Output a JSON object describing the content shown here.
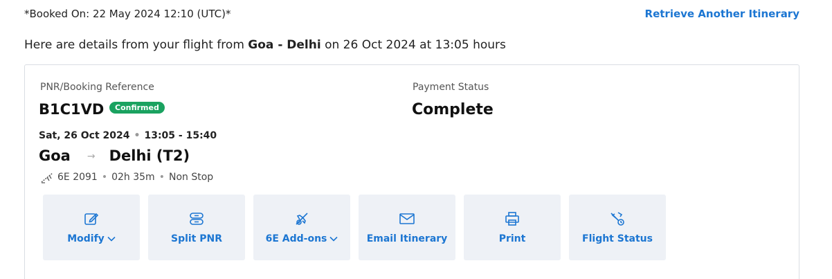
{
  "header": {
    "booked_on": "*Booked On: 22 May 2024 12:10 (UTC)*",
    "retrieve_link": "Retrieve Another Itinerary",
    "details_prefix": "Here are details from your flight from ",
    "details_route": "Goa - Delhi",
    "details_suffix": " on 26 Oct 2024 at 13:05 hours"
  },
  "booking": {
    "pnr_label": "PNR/Booking Reference",
    "pnr": "B1C1VD",
    "status_badge": "Confirmed",
    "payment_label": "Payment Status",
    "payment_value": "Complete"
  },
  "flight": {
    "date": "Sat, 26 Oct 2024",
    "time": "13:05 - 15:40",
    "origin": "Goa",
    "destination": "Delhi (T2)",
    "flight_no": "6E 2091",
    "duration": "02h 35m",
    "stops": "Non Stop"
  },
  "actions": [
    {
      "label": "Modify",
      "icon": "edit-icon",
      "dropdown": true
    },
    {
      "label": "Split PNR",
      "icon": "split-icon",
      "dropdown": false
    },
    {
      "label": "6E Add-ons",
      "icon": "addons-icon",
      "dropdown": true
    },
    {
      "label": "Email Itinerary",
      "icon": "mail-icon",
      "dropdown": false
    },
    {
      "label": "Print",
      "icon": "printer-icon",
      "dropdown": false
    },
    {
      "label": "Flight Status",
      "icon": "flight-status-icon",
      "dropdown": false
    }
  ],
  "colors": {
    "link": "#1c76d2",
    "badge": "#1aa260",
    "tile_bg": "#eef1f6"
  }
}
